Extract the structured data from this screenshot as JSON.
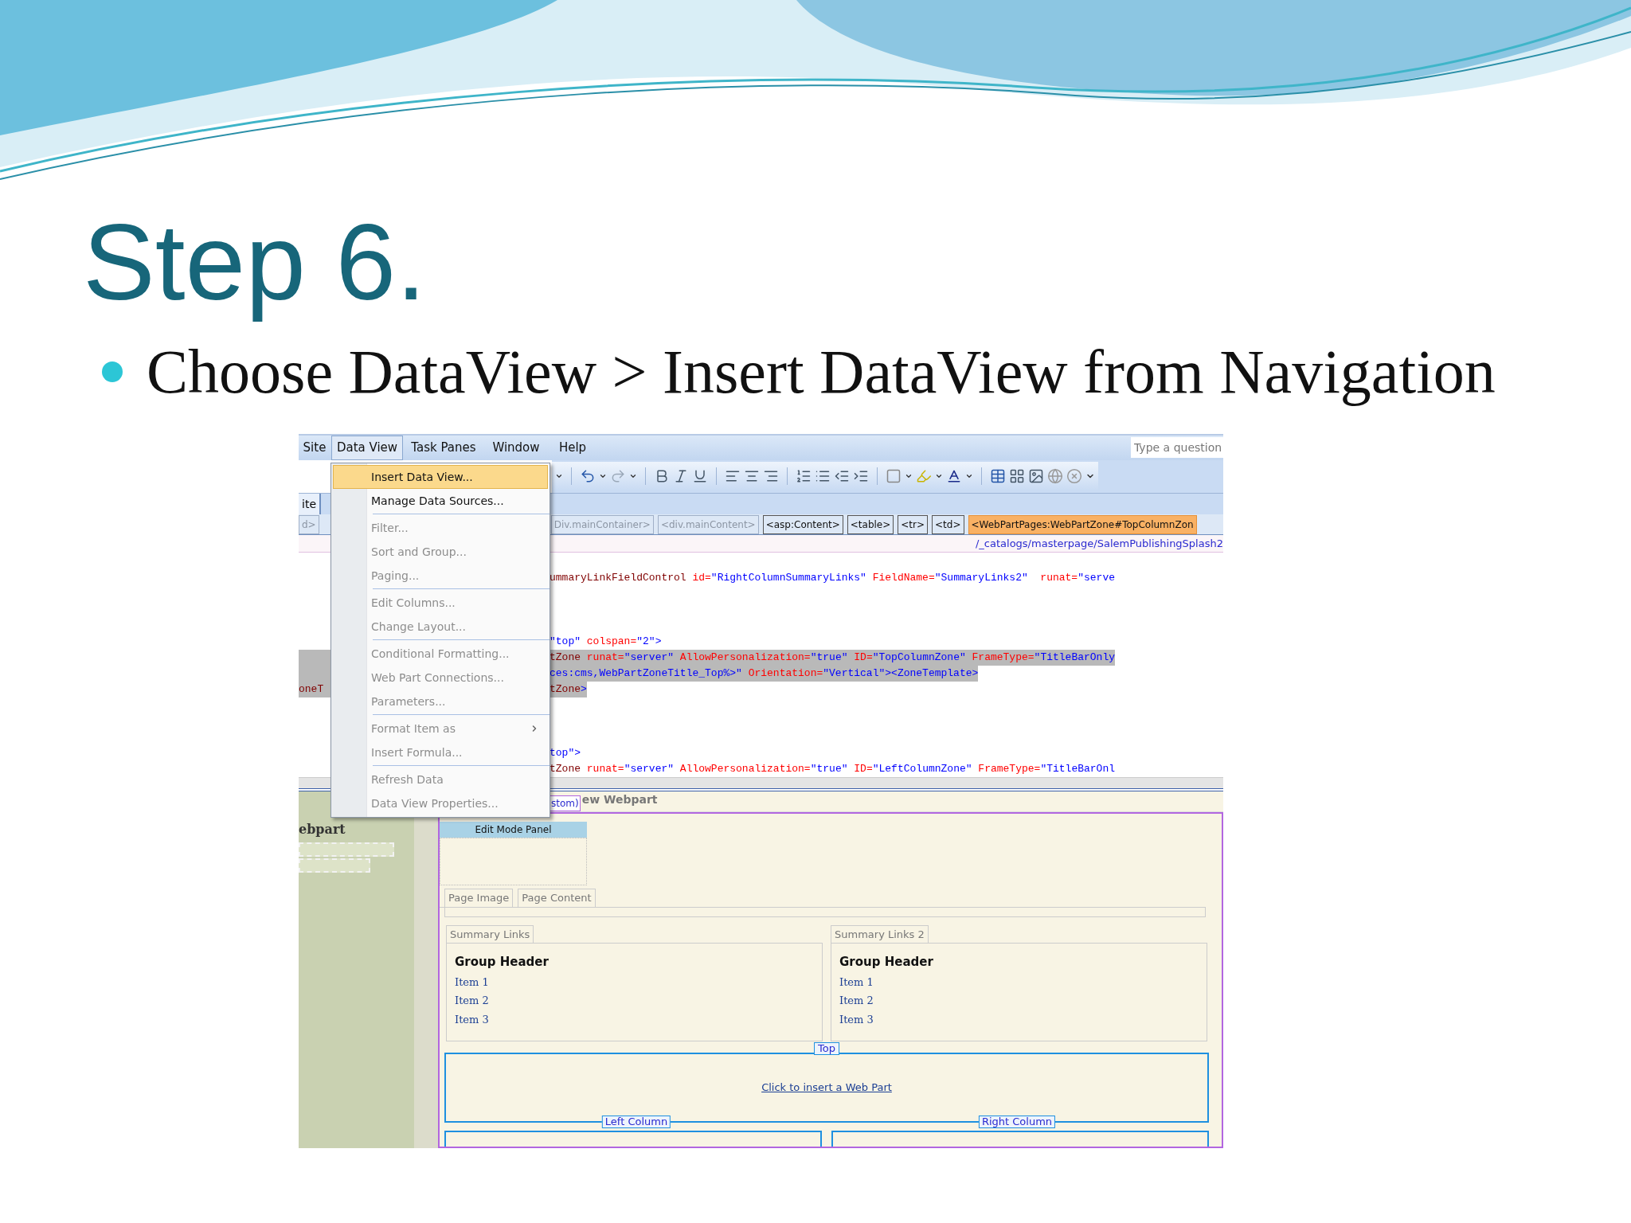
{
  "slide": {
    "title": "Step 6.",
    "bullets": [
      "Choose DataView > Insert DataView from Navigation"
    ]
  },
  "app": {
    "menu_bar": [
      {
        "label": "Site",
        "selected": false
      },
      {
        "label": "Data View",
        "selected": true
      },
      {
        "label": "Task Panes",
        "selected": false
      },
      {
        "label": "Window",
        "selected": false
      },
      {
        "label": "Help",
        "selected": false
      }
    ],
    "search": {
      "placeholder": "Type a question"
    },
    "side_tab": "ite",
    "breadcrumbs": [
      {
        "label": "d>",
        "selected": false,
        "disabled": true
      },
      {
        "label": "Div.mainContainer>",
        "selected": false,
        "disabled": true
      },
      {
        "label": "<div.mainContent>",
        "selected": false,
        "disabled": true
      },
      {
        "label": "<asp:Content>",
        "selected": false,
        "disabled": false
      },
      {
        "label": "<table>",
        "selected": false,
        "disabled": false
      },
      {
        "label": "<tr>",
        "selected": false,
        "disabled": false
      },
      {
        "label": "<td>",
        "selected": false,
        "disabled": false
      },
      {
        "label": "<WebPartPages:WebPartZone#TopColumnZon",
        "selected": true,
        "disabled": false
      }
    ],
    "path": "/_catalogs/masterpage/SalemPublishingSplash2",
    "code_lines": [
      {
        "kind": "code",
        "selected": false,
        "segments": [
          {
            "kind": "tag",
            "text": "ummaryLinkFieldControl"
          },
          {
            "kind": "attr",
            "text": " id="
          },
          {
            "kind": "value",
            "text": "\"RightColumnSummaryLinks\""
          },
          {
            "kind": "attr",
            "text": " FieldName="
          },
          {
            "kind": "value",
            "text": "\"SummaryLinks2\""
          },
          {
            "kind": "attr",
            "text": "  runat="
          },
          {
            "kind": "value",
            "text": "\"serve"
          }
        ]
      },
      {
        "kind": "blank",
        "selected": false
      },
      {
        "kind": "blank",
        "selected": false
      },
      {
        "kind": "blank",
        "selected": false
      },
      {
        "kind": "code",
        "selected": false,
        "segments": [
          {
            "kind": "value",
            "text": "\"top\""
          },
          {
            "kind": "attr",
            "text": " colspan="
          },
          {
            "kind": "value",
            "text": "\"2\">"
          }
        ]
      },
      {
        "kind": "code",
        "selected": true,
        "segments": [
          {
            "kind": "tag",
            "text": "tZone"
          },
          {
            "kind": "attr",
            "text": " runat="
          },
          {
            "kind": "value",
            "text": "\"server\""
          },
          {
            "kind": "attr",
            "text": " AllowPersonalization="
          },
          {
            "kind": "value",
            "text": "\"true\""
          },
          {
            "kind": "attr",
            "text": " ID="
          },
          {
            "kind": "value",
            "text": "\"TopColumnZone\""
          },
          {
            "kind": "attr",
            "text": " FrameType="
          },
          {
            "kind": "value",
            "text": "\"TitleBarOnly"
          }
        ]
      },
      {
        "kind": "code",
        "selected": true,
        "segments": [
          {
            "kind": "value",
            "text": "ces:cms,WebPartZoneTitle_Top%>\""
          },
          {
            "kind": "attr",
            "text": " Orientation="
          },
          {
            "kind": "value",
            "text": "\"Vertical\"><ZoneTemplate>"
          }
        ]
      },
      {
        "kind": "code",
        "selected": true,
        "left": "oneT",
        "segments": [
          {
            "kind": "tag",
            "text": "tZone"
          },
          {
            "kind": "value",
            "text": ">"
          }
        ]
      },
      {
        "kind": "blank",
        "selected": false
      },
      {
        "kind": "blank",
        "selected": false
      },
      {
        "kind": "blank",
        "selected": false
      },
      {
        "kind": "code",
        "selected": false,
        "segments": [
          {
            "kind": "value",
            "text": "top\">"
          }
        ]
      },
      {
        "kind": "code",
        "selected": false,
        "segments": [
          {
            "kind": "tag",
            "text": "tZone"
          },
          {
            "kind": "attr",
            "text": " runat="
          },
          {
            "kind": "value",
            "text": "\"server\""
          },
          {
            "kind": "attr",
            "text": " AllowPersonalization="
          },
          {
            "kind": "value",
            "text": "\"true\""
          },
          {
            "kind": "attr",
            "text": " ID="
          },
          {
            "kind": "value",
            "text": "\"LeftColumnZone\""
          },
          {
            "kind": "attr",
            "text": " FrameType="
          },
          {
            "kind": "value",
            "text": "\"TitleBarOnl"
          }
        ]
      }
    ],
    "menu": [
      {
        "kind": "item",
        "label": "Insert Data View...",
        "selected": true,
        "disabled": false,
        "submenu": false
      },
      {
        "kind": "item",
        "label": "Manage Data Sources...",
        "selected": false,
        "disabled": false,
        "submenu": false
      },
      {
        "kind": "separator"
      },
      {
        "kind": "item",
        "label": "Filter...",
        "selected": false,
        "disabled": true,
        "submenu": false
      },
      {
        "kind": "item",
        "label": "Sort and Group...",
        "selected": false,
        "disabled": true,
        "submenu": false
      },
      {
        "kind": "item",
        "label": "Paging...",
        "selected": false,
        "disabled": true,
        "submenu": false
      },
      {
        "kind": "separator"
      },
      {
        "kind": "item",
        "label": "Edit Columns...",
        "selected": false,
        "disabled": true,
        "submenu": false
      },
      {
        "kind": "item",
        "label": "Change Layout...",
        "selected": false,
        "disabled": true,
        "submenu": false
      },
      {
        "kind": "separator"
      },
      {
        "kind": "item",
        "label": "Conditional Formatting...",
        "selected": false,
        "disabled": true,
        "submenu": false
      },
      {
        "kind": "item",
        "label": "Web Part Connections...",
        "selected": false,
        "disabled": true,
        "submenu": false
      },
      {
        "kind": "item",
        "label": "Parameters...",
        "selected": false,
        "disabled": true,
        "submenu": false
      },
      {
        "kind": "separator"
      },
      {
        "kind": "item",
        "label": "Format Item as",
        "selected": false,
        "disabled": true,
        "submenu": true
      },
      {
        "kind": "item",
        "label": "Insert Formula...",
        "selected": false,
        "disabled": true,
        "submenu": false
      },
      {
        "kind": "separator"
      },
      {
        "kind": "item",
        "label": "Refresh Data",
        "selected": false,
        "disabled": true,
        "submenu": false
      },
      {
        "kind": "item",
        "label": "Data View Properties...",
        "selected": false,
        "disabled": true,
        "submenu": false
      }
    ],
    "design": {
      "left_panel_title": "ebpart",
      "zone_label": "stom)",
      "zone_title": "ew Webpart",
      "edit_panel": "Edit Mode Panel",
      "tabs": [
        "Page Image",
        "Page Content"
      ],
      "summaries": [
        {
          "tab": "Summary Links",
          "header": "Group Header",
          "items": [
            "Item 1",
            "Item 2",
            "Item 3"
          ]
        },
        {
          "tab": "Summary Links 2",
          "header": "Group Header",
          "items": [
            "Item 1",
            "Item 2",
            "Item 3"
          ]
        }
      ],
      "top_label": "Top",
      "insert_link": "Click to insert a Web Part",
      "column_labels": [
        "Left Column",
        "Right Column"
      ]
    }
  }
}
